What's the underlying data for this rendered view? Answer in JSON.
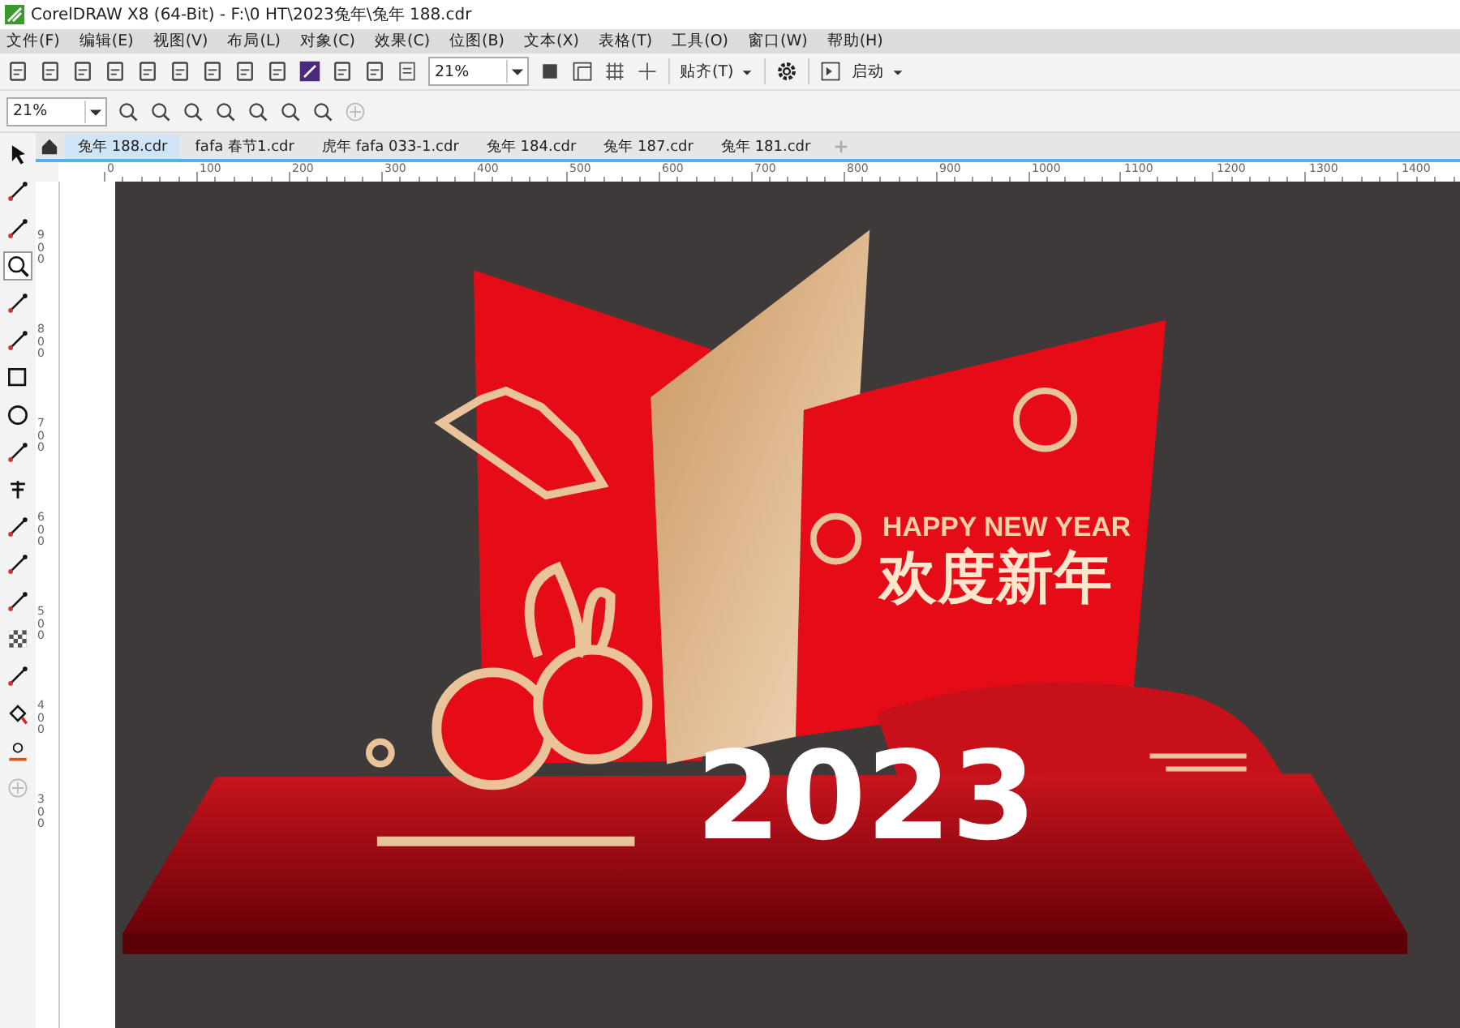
{
  "window": {
    "title": "CorelDRAW X8 (64-Bit) - F:\\0 HT\\2023兔年\\兔年 188.cdr"
  },
  "menu": [
    "文件(F)",
    "编辑(E)",
    "视图(V)",
    "布局(L)",
    "对象(C)",
    "效果(C)",
    "位图(B)",
    "文本(X)",
    "表格(T)",
    "工具(O)",
    "窗口(W)",
    "帮助(H)"
  ],
  "toolbar": {
    "zoom": "21%",
    "snap": "贴齐(T)",
    "launch": "启动"
  },
  "property_bar": {
    "zoom": "21%"
  },
  "tabs": [
    {
      "label": "兔年 188.cdr",
      "selected": true
    },
    {
      "label": "fafa 春节1.cdr",
      "selected": false
    },
    {
      "label": "虎年 fafa 033-1.cdr",
      "selected": false
    },
    {
      "label": "兔年 184.cdr",
      "selected": false
    },
    {
      "label": "兔年 187.cdr",
      "selected": false
    },
    {
      "label": "兔年 181.cdr",
      "selected": false
    }
  ],
  "tools": [
    {
      "selected": false
    },
    {
      "selected": false
    },
    {
      "selected": false
    },
    {
      "selected": true
    },
    {
      "selected": false
    },
    {
      "selected": false
    },
    {
      "selected": false
    },
    {
      "selected": false
    },
    {
      "selected": false
    },
    {
      "selected": false
    },
    {
      "selected": false
    },
    {
      "selected": false
    },
    {
      "selected": false
    },
    {
      "selected": false
    },
    {
      "selected": false
    },
    {
      "selected": false
    },
    {
      "selected": false
    }
  ],
  "ruler_h": [
    "0",
    "100",
    "200",
    "300",
    "400",
    "500",
    "600",
    "700",
    "800",
    "900",
    "1000",
    "1100",
    "1200",
    "1300",
    "1400"
  ],
  "ruler_v": [
    "900",
    "800",
    "700",
    "600",
    "500",
    "400",
    "300"
  ],
  "artwork": {
    "subtitle": "HAPPY NEW YEAR",
    "headline": "欢度新年",
    "year": "2023"
  }
}
